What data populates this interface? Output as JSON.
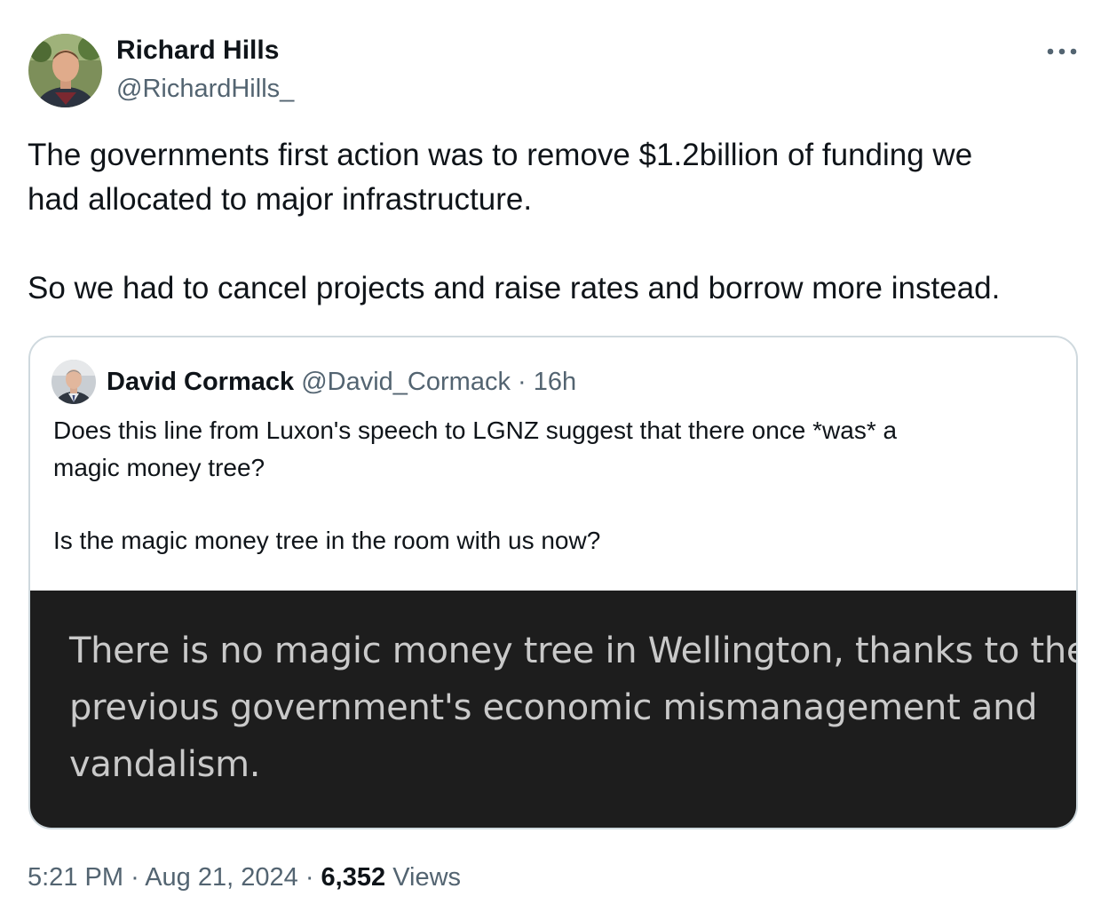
{
  "author": {
    "name": "Richard Hills",
    "handle": "@RichardHills_",
    "avatar_icon": "profile-photo"
  },
  "more_icon": "more-horizontal-icon",
  "tweet": {
    "line_1": "The governments first action was to remove $1.2billion of funding we",
    "line_2": "had allocated to major infrastructure.",
    "line_3": "So we had to cancel projects and raise rates and borrow more instead."
  },
  "quote": {
    "name": "David Cormack",
    "handle": "@David_Cormack",
    "separator": "·",
    "time": "16h",
    "line_1": "Does this line from Luxon's speech to LGNZ suggest that there once *was* a",
    "line_2": "magic money tree?",
    "line_3": "Is the magic money tree in the room with us now?",
    "media_caption": {
      "line_1": "There is no magic money tree in Wellington, thanks to the",
      "line_2": "previous government's economic mismanagement and",
      "line_3": "vandalism."
    }
  },
  "footer": {
    "time": "5:21 PM",
    "separator": "·",
    "date": "Aug 21, 2024",
    "views_count": "6,352",
    "views_label": "Views"
  },
  "colors": {
    "text_primary": "#0f1419",
    "text_secondary": "#536471",
    "border": "#cfd9de",
    "media_bg": "#1d1d1d",
    "media_text": "#c9c9c9"
  }
}
